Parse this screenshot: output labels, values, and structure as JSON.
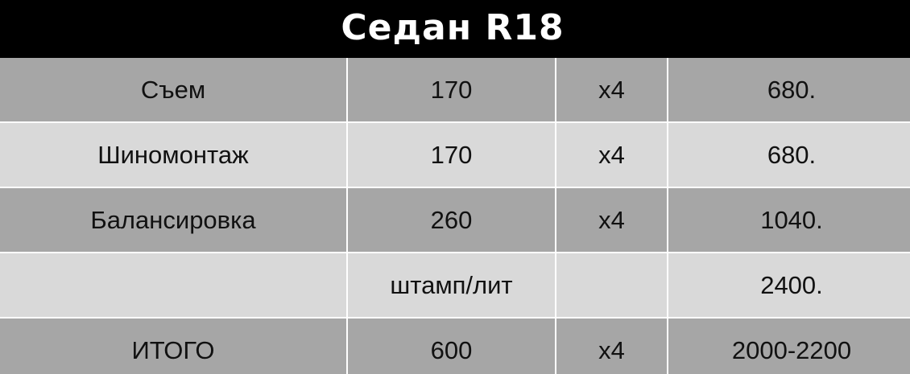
{
  "title": "Седан R18",
  "colors": {
    "header_bg": "#000000",
    "row_dark": "#a6a6a6",
    "row_light": "#d9d9d9",
    "divider": "#ffffff"
  },
  "rows": [
    {
      "service": "Съем",
      "price": "170",
      "qty": "x4",
      "total": "680."
    },
    {
      "service": "Шиномонтаж",
      "price": "170",
      "qty": "x4",
      "total": "680."
    },
    {
      "service": "Балансировка",
      "price": "260",
      "qty": "x4",
      "total": "1040."
    },
    {
      "service": "",
      "price": "штамп/лит",
      "qty": "",
      "total": "2400."
    },
    {
      "service": "ИТОГО",
      "price": "600",
      "qty": "x4",
      "total": "2000-2200"
    }
  ]
}
